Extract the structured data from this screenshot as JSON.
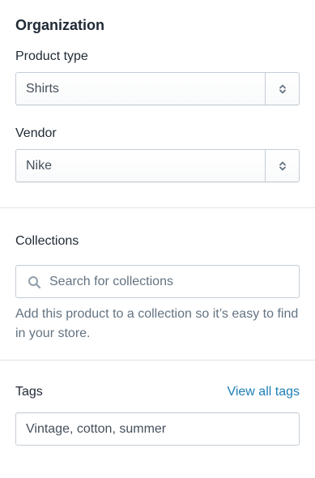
{
  "organization": {
    "title": "Organization",
    "product_type": {
      "label": "Product type",
      "value": "Shirts"
    },
    "vendor": {
      "label": "Vendor",
      "value": "Nike"
    }
  },
  "collections": {
    "label": "Collections",
    "search_placeholder": "Search for collections",
    "help_text": "Add this product to a collection so it’s easy to find in your store."
  },
  "tags": {
    "label": "Tags",
    "view_all_link": "View all tags",
    "value": "Vintage, cotton, summer"
  },
  "icons": {
    "search": "search-icon",
    "select_arrows": "select-arrows-icon"
  },
  "colors": {
    "link": "#1c7fb6",
    "muted_text": "#637381",
    "border": "#c4cdd5"
  }
}
